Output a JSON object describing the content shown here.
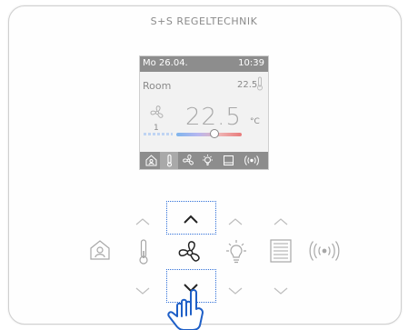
{
  "brand": {
    "name": "S+S REGELTECHNIK"
  },
  "screen": {
    "date": "Mo 26.04.",
    "time": "10:39",
    "room_label": "Room",
    "setpoint": "22.5",
    "temperature": "22.5",
    "unit": "°C",
    "fan_level": "1",
    "selected_tab": "thermometer"
  },
  "colors": {
    "accent_dotted": "#2f6fd8",
    "screen_bar": "#8d8d8d",
    "icon_gray": "#a7a7a7"
  },
  "buttons": [
    {
      "icon": "home-person-icon"
    },
    {
      "icon": "thermometer-icon"
    },
    {
      "icon": "fan-icon"
    },
    {
      "icon": "light-bulb-icon"
    },
    {
      "icon": "blinds-icon"
    },
    {
      "icon": "wireless-signal-icon"
    }
  ]
}
